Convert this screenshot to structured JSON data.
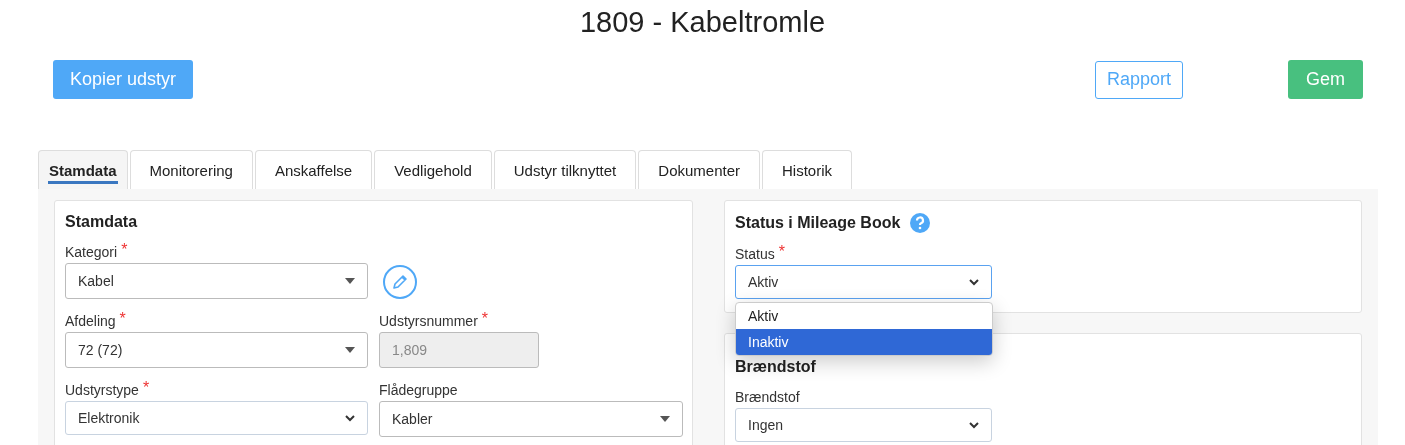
{
  "title": "1809 - Kabeltromle",
  "actions": [
    {
      "label": "Kopier udstyr",
      "kind": "primary"
    },
    {
      "label": "Rapport",
      "kind": "outline"
    },
    {
      "label": "Gem",
      "kind": "success"
    }
  ],
  "tabs": [
    {
      "label": "Stamdata",
      "selected": true
    },
    {
      "label": "Monitorering",
      "selected": false
    },
    {
      "label": "Anskaffelse",
      "selected": false
    },
    {
      "label": "Vedligehold",
      "selected": false
    },
    {
      "label": "Udstyr tilknyttet",
      "selected": false
    },
    {
      "label": "Dokumenter",
      "selected": false
    },
    {
      "label": "Historik",
      "selected": false
    }
  ],
  "stamdata": {
    "heading": "Stamdata",
    "fields": [
      {
        "label": "Kategori",
        "mark": "*",
        "value": "Kabel",
        "kind": "combo"
      },
      {
        "kind": "edit"
      },
      {
        "label": "Afdeling",
        "mark": "*",
        "value": "72 (72)",
        "kind": "combo"
      },
      {
        "label": "Udstyrsnummer",
        "mark": "*",
        "value": "1,809",
        "kind": "readonly"
      },
      {
        "label": "Udstyrstype",
        "mark": "*",
        "value": "Elektronik",
        "kind": "select"
      },
      {
        "label": "Flådegruppe",
        "value": "Kabler",
        "kind": "combo"
      }
    ]
  },
  "status_card": {
    "heading": "Status i Mileage Book",
    "field": {
      "label": "Status",
      "mark": "*",
      "value": "Aktiv"
    },
    "options": [
      {
        "label": "Aktiv",
        "selected": false
      },
      {
        "label": "Inaktiv",
        "selected": true
      }
    ]
  },
  "fuel_card": {
    "heading": "Brændstof",
    "field": {
      "label": "Brændstof",
      "value": "Ingen"
    }
  }
}
